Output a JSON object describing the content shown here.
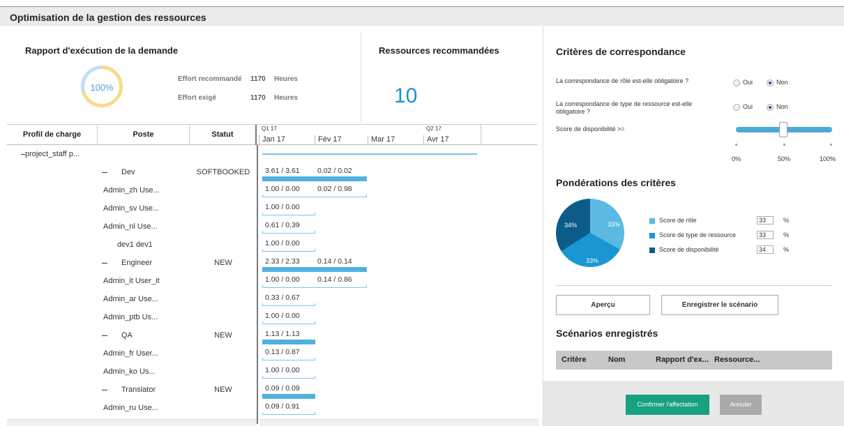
{
  "page_title": "Optimisation de la gestion des ressources",
  "report": {
    "title": "Rapport d'exécution de la demande",
    "progress": "100%",
    "progress_fraction": 1.0,
    "rows": [
      {
        "label": "Effort recommandé",
        "value": "1170",
        "unit": "Heures"
      },
      {
        "label": "Effort exigé",
        "value": "1170",
        "unit": "Heures"
      }
    ]
  },
  "resources": {
    "title": "Ressources recommandées",
    "count": "10"
  },
  "grid": {
    "headers": {
      "profil": "Profil de charge",
      "poste": "Poste",
      "statut": "Statut"
    },
    "timeline": {
      "quarters": [
        "Q1 17",
        "Q2 17"
      ],
      "months": [
        "Jan 17",
        "Fév 17",
        "Mar 17",
        "Avr 17"
      ]
    },
    "rows": [
      {
        "profil": "project_staff p...",
        "collapse": true,
        "poste": "",
        "statut": "",
        "bars": [],
        "level": 0
      },
      {
        "profil": "",
        "poste": "Dev",
        "poste_collapse": true,
        "statut": "SOFTBOOKED",
        "bars": [
          "3.61 / 3.61",
          "0.02 / 0.02"
        ],
        "fill": true
      },
      {
        "profil": "",
        "poste": "Admin_zh Use...",
        "statut": "",
        "bars": [
          "1.00 / 0.00",
          "0.02 / 0.98"
        ]
      },
      {
        "profil": "",
        "poste": "Admin_sv Use...",
        "statut": "",
        "bars": [
          "1.00 / 0.00"
        ]
      },
      {
        "profil": "",
        "poste": "Admin_nl Use...",
        "statut": "",
        "bars": [
          "0.61 / 0.39"
        ]
      },
      {
        "profil": "",
        "poste": "dev1 dev1",
        "statut": "",
        "bars": [
          "1.00 / 0.00"
        ]
      },
      {
        "profil": "",
        "poste": "Engineer",
        "poste_collapse": true,
        "statut": "NEW",
        "bars": [
          "2.33 / 2.33",
          "0.14 / 0.14"
        ],
        "fill": true
      },
      {
        "profil": "",
        "poste": "Admin_it User_it",
        "statut": "",
        "bars": [
          "1.00 / 0.00",
          "0.14 / 0.86"
        ]
      },
      {
        "profil": "",
        "poste": "Admin_ar Use...",
        "statut": "",
        "bars": [
          "0.33 / 0.67"
        ]
      },
      {
        "profil": "",
        "poste": "Admin_ptb Us...",
        "statut": "",
        "bars": [
          "1.00 / 0.00"
        ]
      },
      {
        "profil": "",
        "poste": "QA",
        "poste_collapse": true,
        "statut": "NEW",
        "bars": [
          "1.13 / 1.13"
        ],
        "fill": true
      },
      {
        "profil": "",
        "poste": "Admin_fr User...",
        "statut": "",
        "bars": [
          "0.13 / 0.87"
        ]
      },
      {
        "profil": "",
        "poste": "Admin_ko Us...",
        "statut": "",
        "bars": [
          "1.00 / 0.00"
        ]
      },
      {
        "profil": "",
        "poste": "Translator",
        "poste_collapse": true,
        "statut": "NEW",
        "bars": [
          "0.09 / 0.09"
        ],
        "fill": true
      },
      {
        "profil": "",
        "poste": "Admin_ru Use...",
        "statut": "",
        "bars": [
          "0.09 / 0.91"
        ]
      }
    ]
  },
  "criteria": {
    "title": "Critères de correspondance",
    "role_question": "La correspondance de rôle est-elle obligatoire ?",
    "type_question": "La correspondance de type de ressource est-elle obligatoire ?",
    "oui": "Oui",
    "non": "Non",
    "role_selected": "Non",
    "type_selected": "Non",
    "availability_label": "Score de disponibilité   >=",
    "slider_value_percent": 50,
    "slider_labels": [
      "0%",
      "50%",
      "100%"
    ]
  },
  "weights": {
    "title": "Pondérations des critères",
    "items": [
      {
        "label": "Score de rôle",
        "value": "33",
        "pct": "%",
        "color": "#5bb9e3"
      },
      {
        "label": "Score de type de ressource",
        "value": "33",
        "pct": "%",
        "color": "#1a96d3"
      },
      {
        "label": "Score de disponibilité",
        "value": "34",
        "pct": "%",
        "color": "#0c5c8a"
      }
    ],
    "pie_labels": [
      "33%",
      "33%",
      "34%"
    ]
  },
  "buttons": {
    "preview": "Aperçu",
    "save_scenario": "Enregistrer le scénario",
    "confirm": "Confirmer l'affectation",
    "cancel": "Annuler"
  },
  "scenarios": {
    "title": "Scénarios enregistrés",
    "columns": [
      "Critère",
      "Nom",
      "Rapport d'ex...",
      "Ressource..."
    ]
  },
  "colors": {
    "accent": "#1a91d1",
    "confirm": "#17a082",
    "bar": "#4fb1e0"
  }
}
